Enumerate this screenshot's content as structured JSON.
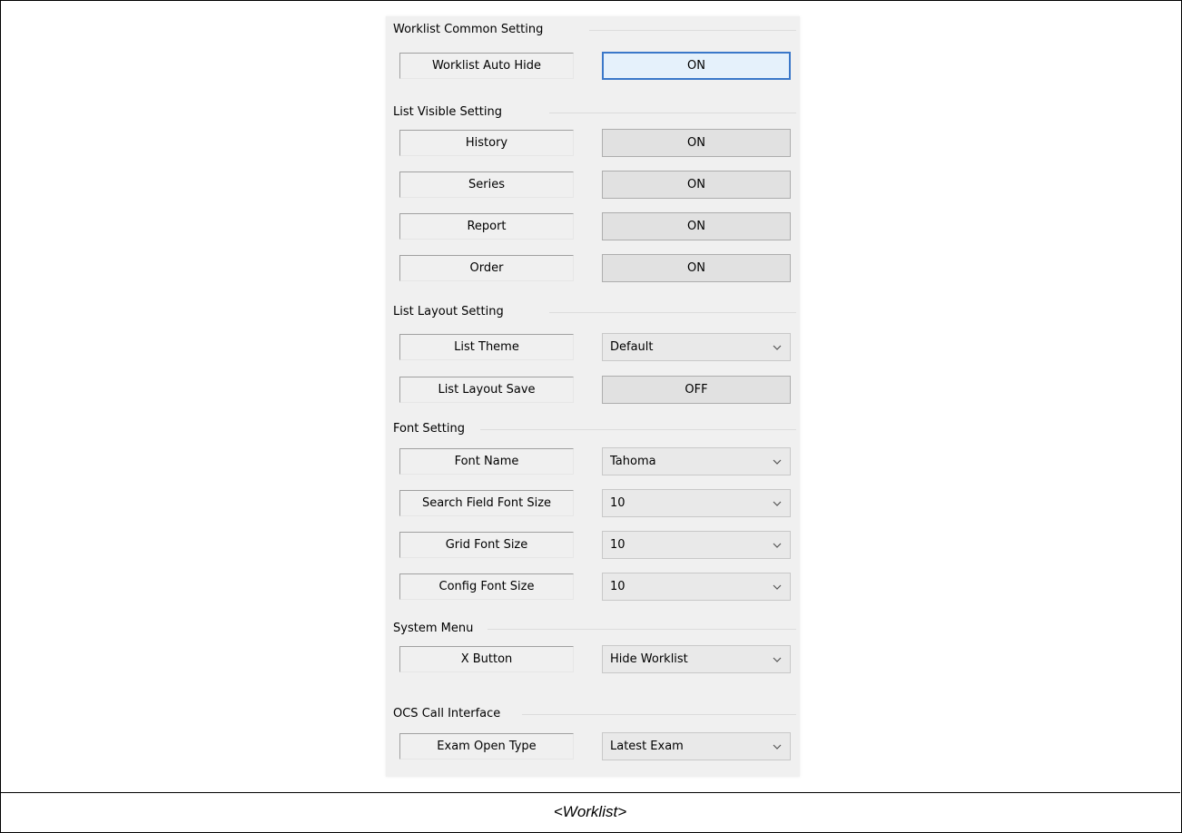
{
  "caption": "<Worklist>",
  "groups": {
    "common": {
      "title": "Worklist Common Setting",
      "rows": [
        {
          "label": "Worklist Auto Hide",
          "value": "ON"
        }
      ]
    },
    "visible": {
      "title": "List Visible Setting",
      "rows": [
        {
          "label": "History",
          "value": "ON"
        },
        {
          "label": "Series",
          "value": "ON"
        },
        {
          "label": "Report",
          "value": "ON"
        },
        {
          "label": "Order",
          "value": "ON"
        }
      ]
    },
    "layout": {
      "title": "List Layout Setting",
      "rows": [
        {
          "label": "List Theme",
          "value": "Default"
        },
        {
          "label": "List Layout Save",
          "value": "OFF"
        }
      ]
    },
    "font": {
      "title": "Font Setting",
      "rows": [
        {
          "label": "Font Name",
          "value": "Tahoma"
        },
        {
          "label": "Search Field Font Size",
          "value": "10"
        },
        {
          "label": "Grid Font Size",
          "value": "10"
        },
        {
          "label": "Config Font Size",
          "value": "10"
        }
      ]
    },
    "system": {
      "title": "System Menu",
      "rows": [
        {
          "label": "X Button",
          "value": "Hide Worklist"
        }
      ]
    },
    "ocs": {
      "title": "OCS Call Interface",
      "rows": [
        {
          "label": "Exam Open Type",
          "value": "Latest Exam"
        }
      ]
    }
  },
  "icons": {
    "dropdown": "chevron-down-icon"
  },
  "colors": {
    "focus_border": "#3a78c9",
    "panel_bg": "#f0f0f0"
  }
}
